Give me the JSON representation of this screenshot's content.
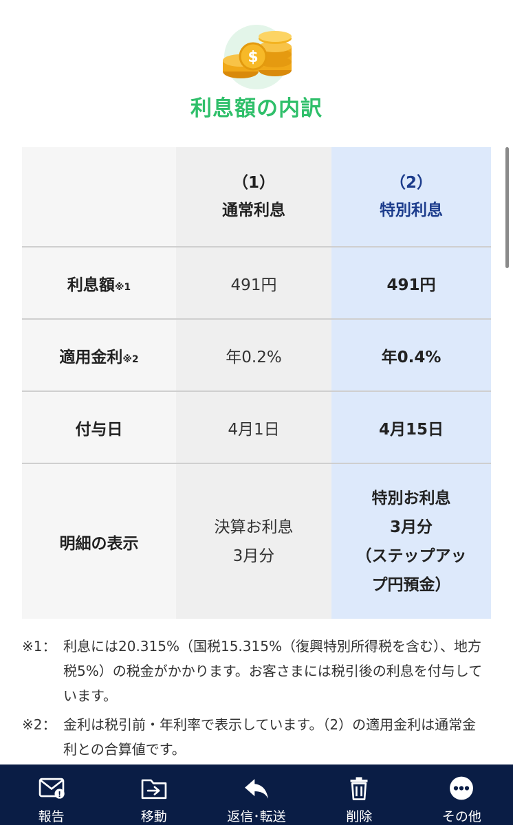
{
  "title": "利息額の内訳",
  "table": {
    "header": {
      "col2_num": "（1）",
      "col2_label": "通常利息",
      "col3_num": "（2）",
      "col3_label": "特別利息"
    },
    "rows": [
      {
        "label": "利息額",
        "mark": "※1",
        "normal": "491円",
        "special": "491円"
      },
      {
        "label": "適用金利",
        "mark": "※2",
        "normal": "年0.2%",
        "special": "年0.4%"
      },
      {
        "label": "付与日",
        "normal": "4月1日",
        "special": "4月15日"
      }
    ],
    "detail_row": {
      "label": "明細の表示",
      "normal_lines": [
        "決算お利息",
        "3月分"
      ],
      "special_lines": [
        "特別お利息",
        "3月分",
        "（ステップアッ",
        "プ円預金）"
      ]
    }
  },
  "notes": [
    {
      "key": "※1：",
      "text": "利息には20.315%（国税15.315%（復興特別所得税を含む）、地方税5%）の税金がかかります。お客さまには税引後の利息を付与しています。"
    },
    {
      "key": "※2：",
      "text": "金利は税引前・年利率で表示しています。（2）の適用金利は通常金利との合算値です。"
    }
  ],
  "toolbar": [
    {
      "label": "報告",
      "icon": "mail-report-icon"
    },
    {
      "label": "移動",
      "icon": "move-folder-icon"
    },
    {
      "label": "返信･転送",
      "icon": "reply-forward-icon"
    },
    {
      "label": "削除",
      "icon": "trash-icon"
    },
    {
      "label": "その他",
      "icon": "more-icon"
    }
  ],
  "colors": {
    "title": "#2fbf6a",
    "special_column_bg": "#dde9fb",
    "special_header_text": "#1c3c8c",
    "toolbar_bg": "#0a1d45"
  }
}
